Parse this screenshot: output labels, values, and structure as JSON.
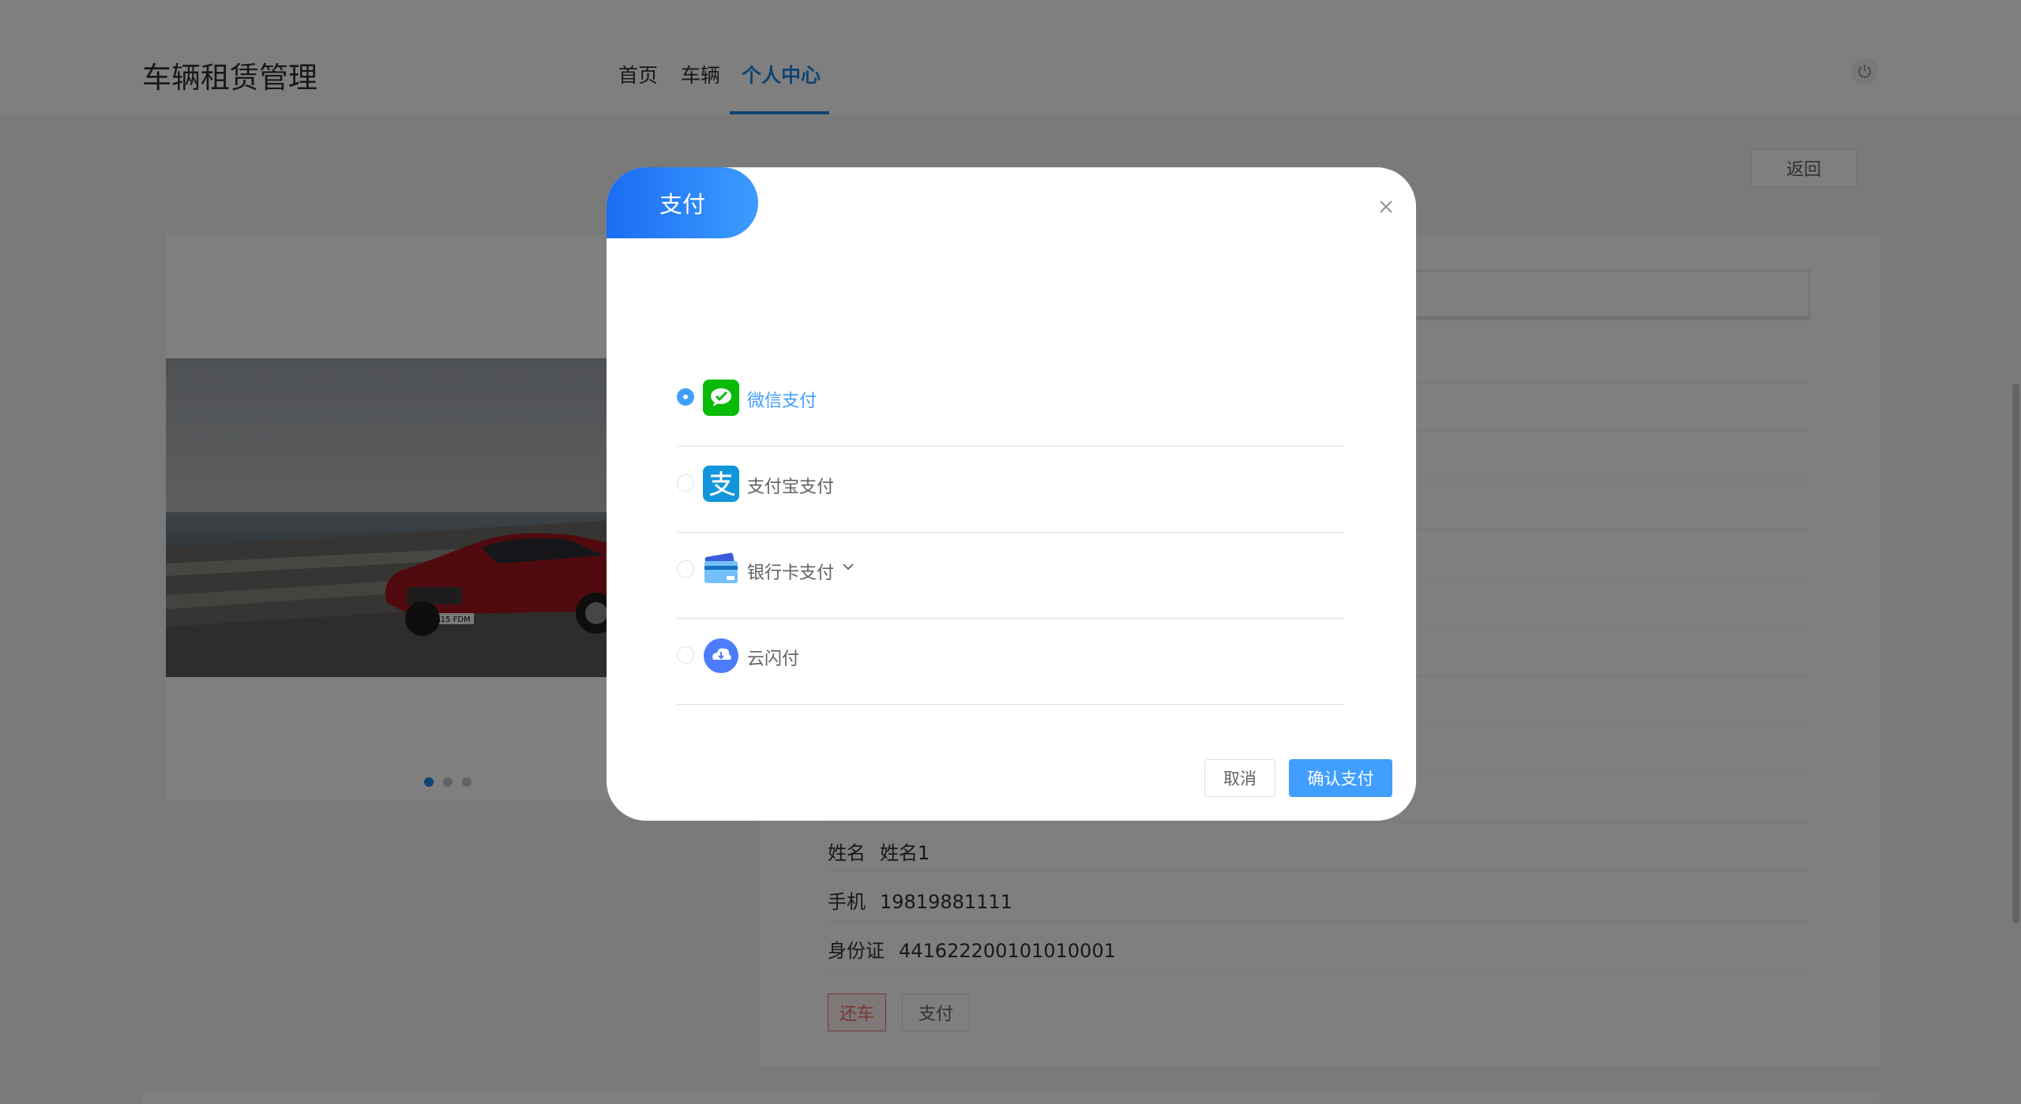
{
  "header": {
    "brand": "车辆租赁管理",
    "nav": [
      "首页",
      "车辆",
      "个人中心"
    ],
    "active_nav": "个人中心"
  },
  "toolbar": {
    "back_label": "返回"
  },
  "carousel": {
    "slides": 3,
    "active_index": 0,
    "plate_text": "BA15 FDM"
  },
  "order_info": {
    "name_label": "姓名",
    "name_value": "姓名1",
    "phone_label": "手机",
    "phone_value": "19819881111",
    "id_label": "身份证",
    "id_value": "441622200101010001"
  },
  "actions": {
    "return_label": "还车",
    "pay_label": "支付"
  },
  "dialog": {
    "title": "支付",
    "options": [
      {
        "label": "微信支付",
        "icon": "wechat-pay-icon",
        "selected": true
      },
      {
        "label": "支付宝支付",
        "icon": "alipay-icon",
        "selected": false
      },
      {
        "label": "银行卡支付",
        "icon": "bank-card-icon",
        "selected": false,
        "has_dropdown": true
      },
      {
        "label": "云闪付",
        "icon": "unionpay-quickpass-icon",
        "selected": false
      }
    ],
    "cancel_label": "取消",
    "confirm_label": "确认支付"
  },
  "colors": {
    "primary": "#409eff",
    "title_gradient_start": "#1b6cf2",
    "title_gradient_end": "#3c9cff",
    "wechat": "#09bb07",
    "alipay": "#1296db",
    "danger": "#f56c6c"
  }
}
